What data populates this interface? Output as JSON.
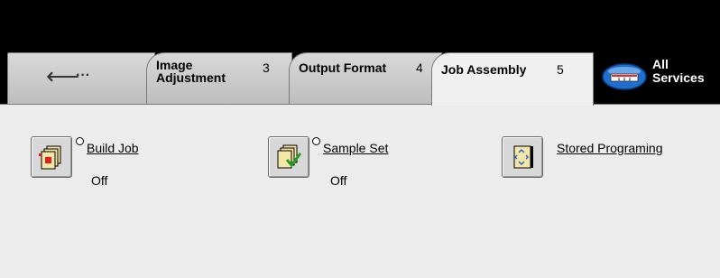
{
  "tabs": {
    "back": {
      "arrow": "⟵",
      "dots": "···"
    },
    "image_adjustment": {
      "line1": "Image",
      "line2": "Adjustment",
      "number": "3"
    },
    "output_format": {
      "label": "Output Format",
      "number": "4"
    },
    "job_assembly": {
      "label": "Job Assembly",
      "number": "5"
    },
    "all_services": {
      "line1": "All",
      "line2": "Services",
      "icon": "all-services-icon"
    }
  },
  "features": {
    "build_job": {
      "label": "Build Job",
      "value": "Off",
      "icon": "build-job-icon"
    },
    "sample_set": {
      "label": "Sample Set",
      "value": "Off",
      "icon": "sample-set-icon"
    },
    "stored_programming": {
      "label": "Stored Programing",
      "icon": "stored-programming-icon"
    }
  },
  "colors": {
    "active_tab": "#f0f0f0",
    "inactive_tab": "#c8c8c8",
    "content_bg": "#ececec",
    "accent_blue": "#1e6fd0"
  }
}
